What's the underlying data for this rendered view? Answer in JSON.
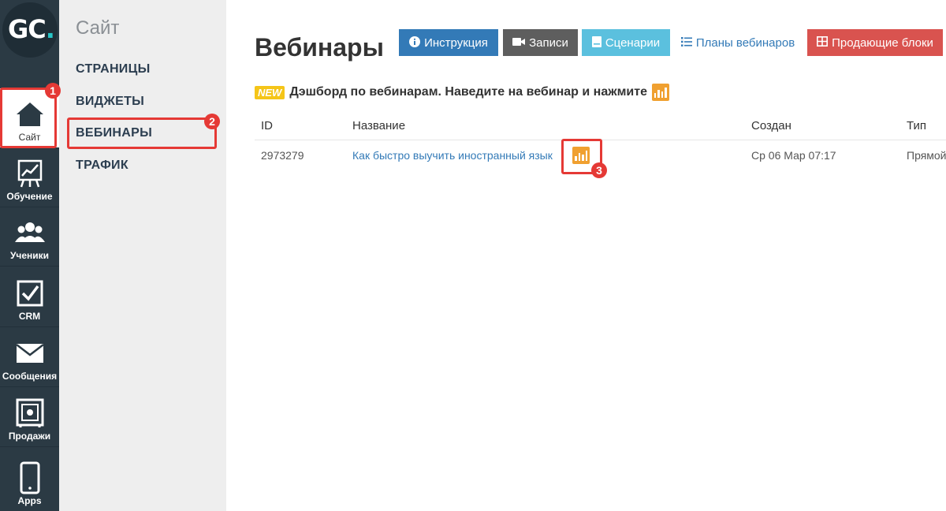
{
  "logo": {
    "letters": "GC",
    "dot": "."
  },
  "rail": {
    "items": [
      {
        "label": "Сайт",
        "icon": "house-icon"
      },
      {
        "label": "Обучение",
        "icon": "training-board-icon"
      },
      {
        "label": "Ученики",
        "icon": "users-icon"
      },
      {
        "label": "CRM",
        "icon": "checkbox-icon"
      },
      {
        "label": "Сообщения",
        "icon": "envelope-icon"
      },
      {
        "label": "Продажи",
        "icon": "safe-icon"
      },
      {
        "label": "Apps",
        "icon": "phone-icon"
      }
    ]
  },
  "submenu": {
    "title": "Сайт",
    "items": [
      "СТРАНИЦЫ",
      "ВИДЖЕТЫ",
      "ВЕБИНАРЫ",
      "ТРАФИК"
    ]
  },
  "page": {
    "title": "Вебинары"
  },
  "toolbar": {
    "instruction": "Инструкция",
    "records": "Записи",
    "scenarios": "Сценарии",
    "plans": "Планы вебинаров",
    "selling_blocks": "Продающие блоки"
  },
  "notice": {
    "badge": "NEW",
    "text": "Дэшборд по вебинарам. Наведите на вебинар и нажмите"
  },
  "table": {
    "headers": [
      "ID",
      "Название",
      "Создан",
      "Тип"
    ],
    "rows": [
      {
        "id": "2973279",
        "name": "Как быстро выучить иностранный язык",
        "created": "Ср 06 Мар 07:17",
        "type": "Прямой"
      }
    ]
  },
  "annotations": [
    "1",
    "2",
    "3"
  ],
  "colors": {
    "rail": "#2b3a44",
    "submenu": "#eeeeee",
    "accent_red": "#e53935",
    "primary": "#337ab7",
    "danger": "#d9534f",
    "info": "#5bc0de"
  }
}
